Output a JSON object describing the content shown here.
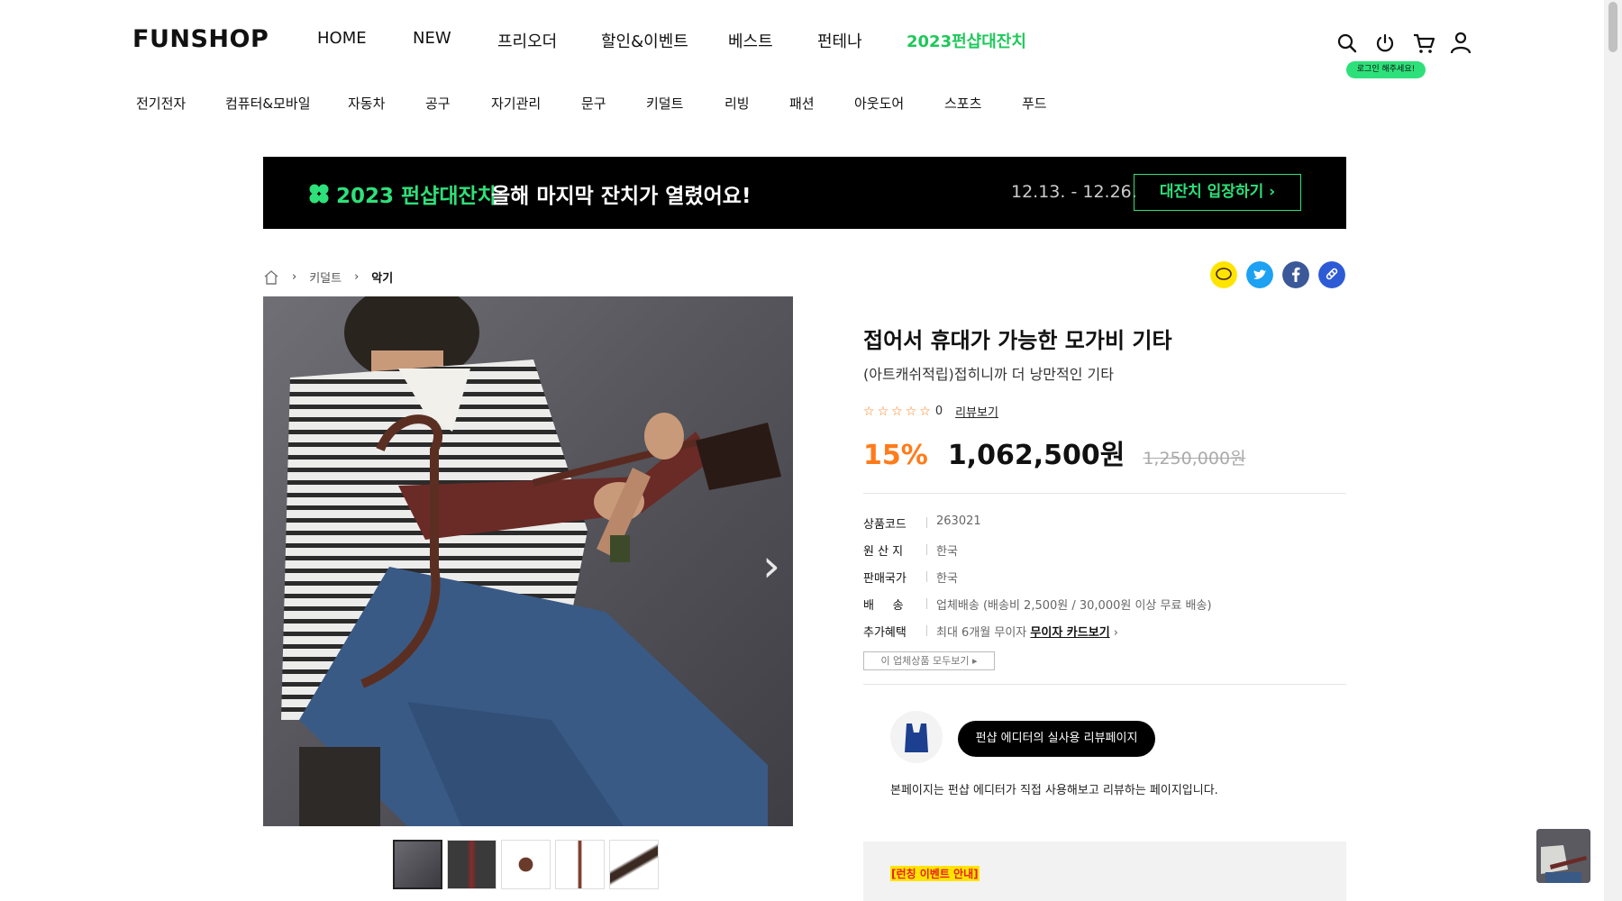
{
  "header": {
    "logo": "FUNSHOP",
    "nav": [
      "HOME",
      "NEW",
      "프리오더",
      "할인&이벤트",
      "베스트",
      "펀테나",
      "2023펀샵대잔치"
    ],
    "login_tip": "로그인 해주세요!"
  },
  "categories": [
    "전기전자",
    "컴퓨터&모바일",
    "자동차",
    "공구",
    "자기관리",
    "문구",
    "키덜트",
    "리빙",
    "패션",
    "아웃도어",
    "스포츠",
    "푸드"
  ],
  "banner": {
    "title": "2023 펀샵대잔치",
    "subtitle": "올해 마지막 잔치가 열렸어요!",
    "date": "12.13. - 12.26.",
    "button": "대잔치 입장하기"
  },
  "breadcrumb": {
    "items": [
      "키덜트",
      "악기"
    ]
  },
  "product": {
    "title": "접어서 휴대가 가능한 모가비 기타",
    "subtitle": "(아트캐쉬적립)접히니까 더 낭만적인 기타",
    "rating_count": "0",
    "review_link": "리뷰보기",
    "discount": "15%",
    "price": "1,062,500원",
    "original_price": "1,250,000원",
    "specs": [
      {
        "key": "상품코드",
        "value": "263021"
      },
      {
        "key": "원 산 지",
        "value": "한국"
      },
      {
        "key": "판매국가",
        "value": "한국"
      },
      {
        "key": "배     송",
        "value": "업체배송 (배송비 2,500원 / 30,000원 이상 무료 배송)"
      },
      {
        "key": "추가혜택",
        "value": "최대 6개월 무이자",
        "link": "무이자 카드보기"
      }
    ],
    "vendor_button": "이 업체상품 모두보기"
  },
  "editor": {
    "pill": "펀샵 에디터의 실사용 리뷰페이지",
    "desc": "본페이지는 펀샵 에디터가 직접 사용해보고 리뷰하는 페이지입니다."
  },
  "event": {
    "title": "[런칭 이벤트 안내]"
  },
  "colors": {
    "accent_green": "#2ee07a",
    "discount_orange": "#ff7b1b",
    "star_orange": "#ff7b1b",
    "kakao_yellow": "#ffe400",
    "twitter_blue": "#1da1f2",
    "facebook_blue": "#3b5998",
    "link_blue": "#2d5bd6"
  },
  "icons": {
    "search": "search-icon",
    "power": "power-icon",
    "cart": "cart-icon",
    "user": "user-icon",
    "home": "home-icon",
    "next": "chevron-right-icon"
  }
}
